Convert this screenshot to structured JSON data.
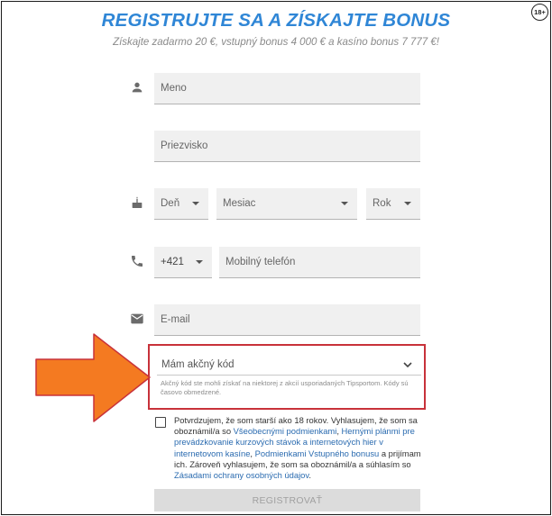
{
  "header": {
    "title": "REGISTRUJTE SA A ZÍSKAJTE BONUS",
    "subtitle": "Získajte zadarmo 20 €, vstupný bonus 4 000 € a kasíno bonus 7 777 €!",
    "age_badge": "18+"
  },
  "form": {
    "first_name": {
      "placeholder": "Meno"
    },
    "last_name": {
      "placeholder": "Priezvisko"
    },
    "birth_day": {
      "label": "Deň"
    },
    "birth_month": {
      "label": "Mesiac"
    },
    "birth_year": {
      "label": "Rok"
    },
    "phone_prefix": {
      "value": "+421"
    },
    "phone": {
      "placeholder": "Mobilný telefón"
    },
    "email": {
      "placeholder": "E-mail"
    },
    "promo": {
      "title": "Mám akčný kód",
      "description": "Akčný kód ste mohli získať na niektorej z akcií usporiadaných Tipsportom. Kódy sú časovo obmedzené."
    },
    "consent": {
      "part1": "Potvrdzujem, že som starší ako 18 rokov. Vyhlasujem, že som sa oboznámil/a so ",
      "link1": "Všeobecnými podmienkami",
      "part2": ", ",
      "link2": "Hernými plánmi pre prevádzkovanie kurzových stávok a internetových hier v internetovom kasíne",
      "part3": ", ",
      "link3": "Podmienkami Vstupného bonusu",
      "part4": " a prijímam ich. Zároveň vyhlasujem, že som sa oboznámil/a a súhlasím so ",
      "link4": "Zásadami ochrany osobných údajov",
      "part5": "."
    },
    "submit_label": "REGISTROVAŤ"
  },
  "icons": {
    "name": "person-icon",
    "birthdate": "cake-icon",
    "phone": "phone-icon",
    "email": "envelope-icon",
    "promo_toggle": "chevron-down-icon",
    "callout": "arrow-right-icon"
  },
  "colors": {
    "title": "#2f86d6",
    "link": "#2a6bb0",
    "highlight_border": "#c8323a",
    "arrow_fill": "#f47a21",
    "arrow_stroke": "#c8323a",
    "field_bg": "#f0f0f0",
    "button_bg": "#dcdcdc"
  }
}
